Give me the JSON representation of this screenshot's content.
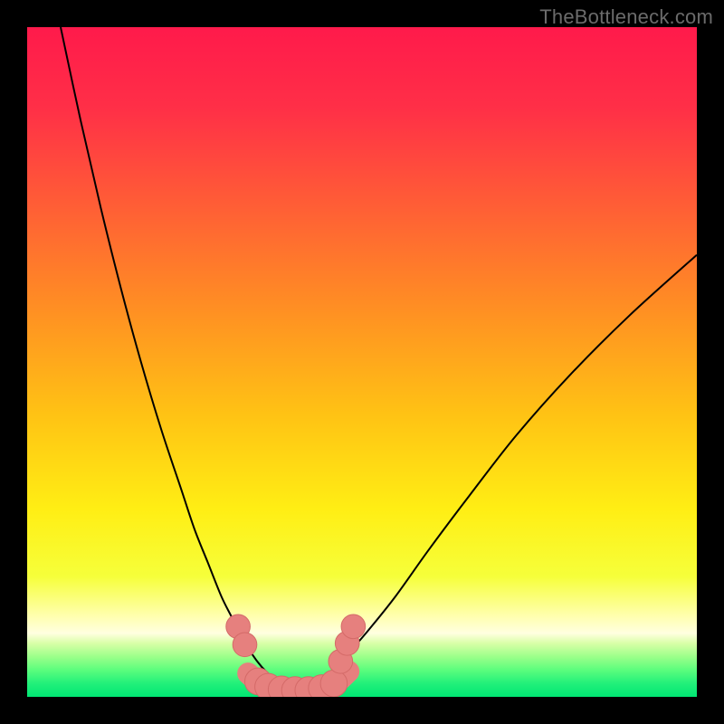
{
  "watermark": "TheBottleneck.com",
  "colors": {
    "frame": "#000000",
    "curve_stroke": "#000000",
    "marker_fill": "#e6807e",
    "marker_stroke": "#d46a68",
    "watermark_text": "#6b6b6b",
    "gradient_stops": [
      {
        "offset": 0.0,
        "color": "#ff1a4b"
      },
      {
        "offset": 0.12,
        "color": "#ff2f47"
      },
      {
        "offset": 0.28,
        "color": "#ff6234"
      },
      {
        "offset": 0.43,
        "color": "#ff9222"
      },
      {
        "offset": 0.58,
        "color": "#ffc314"
      },
      {
        "offset": 0.72,
        "color": "#ffee14"
      },
      {
        "offset": 0.82,
        "color": "#f6ff3a"
      },
      {
        "offset": 0.88,
        "color": "#ffffb0"
      },
      {
        "offset": 0.905,
        "color": "#ffffe0"
      },
      {
        "offset": 0.92,
        "color": "#d9ffa8"
      },
      {
        "offset": 0.94,
        "color": "#9cff8a"
      },
      {
        "offset": 0.96,
        "color": "#5bfd7d"
      },
      {
        "offset": 0.98,
        "color": "#22f07a"
      },
      {
        "offset": 1.0,
        "color": "#00e673"
      }
    ]
  },
  "chart_data": {
    "type": "line",
    "title": "",
    "xlabel": "",
    "ylabel": "",
    "xlim": [
      0,
      100
    ],
    "ylim": [
      0,
      100
    ],
    "grid": false,
    "series": [
      {
        "name": "left-curve",
        "x": [
          5,
          8,
          11,
          14,
          17,
          20,
          23,
          25,
          27,
          29,
          30.5,
          32,
          33.5,
          35,
          36.5,
          38
        ],
        "y": [
          100,
          86,
          73,
          61,
          50,
          40,
          31,
          25,
          20,
          15,
          12,
          9,
          6.5,
          4.5,
          3,
          2
        ]
      },
      {
        "name": "right-curve",
        "x": [
          44,
          46,
          48,
          51,
          55,
          60,
          66,
          73,
          81,
          90,
          100
        ],
        "y": [
          2,
          4,
          6.5,
          10,
          15,
          22,
          30,
          39,
          48,
          57,
          66
        ]
      },
      {
        "name": "bottom-hump",
        "x": [
          33,
          34.5,
          36,
          37.5,
          39,
          40.5,
          42,
          43.5,
          45,
          46.5,
          48
        ],
        "y": [
          3.5,
          2.2,
          1.4,
          1.0,
          0.9,
          0.9,
          0.9,
          1.0,
          1.5,
          2.4,
          3.8
        ]
      }
    ],
    "markers": [
      {
        "x": 31.5,
        "y": 10.5,
        "r": 1.8
      },
      {
        "x": 32.5,
        "y": 7.8,
        "r": 1.8
      },
      {
        "x": 34.5,
        "y": 2.3,
        "r": 2.0
      },
      {
        "x": 36.0,
        "y": 1.5,
        "r": 2.0
      },
      {
        "x": 38.0,
        "y": 1.1,
        "r": 2.0
      },
      {
        "x": 40.0,
        "y": 1.0,
        "r": 2.0
      },
      {
        "x": 42.0,
        "y": 1.0,
        "r": 2.0
      },
      {
        "x": 44.0,
        "y": 1.3,
        "r": 2.0
      },
      {
        "x": 45.8,
        "y": 2.0,
        "r": 2.0
      },
      {
        "x": 46.8,
        "y": 5.3,
        "r": 1.8
      },
      {
        "x": 47.8,
        "y": 8.0,
        "r": 1.8
      },
      {
        "x": 48.7,
        "y": 10.5,
        "r": 1.8
      }
    ]
  }
}
